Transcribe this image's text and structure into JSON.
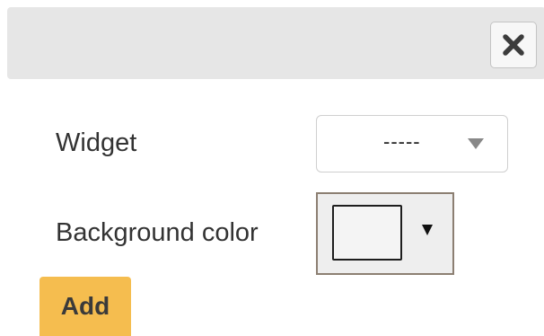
{
  "header": {
    "close_icon": "close-icon"
  },
  "form": {
    "widget": {
      "label": "Widget",
      "selected_value": "-----",
      "caret_icon": "chevron-down-icon"
    },
    "background_color": {
      "label": "Background color",
      "current_color": "#f4f4f4",
      "caret_icon": "dropdown-triangle-icon"
    }
  },
  "actions": {
    "add_label": "Add"
  },
  "colors": {
    "header_bg": "#e6e6e6",
    "add_button": "#f5bd4f",
    "text": "#333333"
  }
}
